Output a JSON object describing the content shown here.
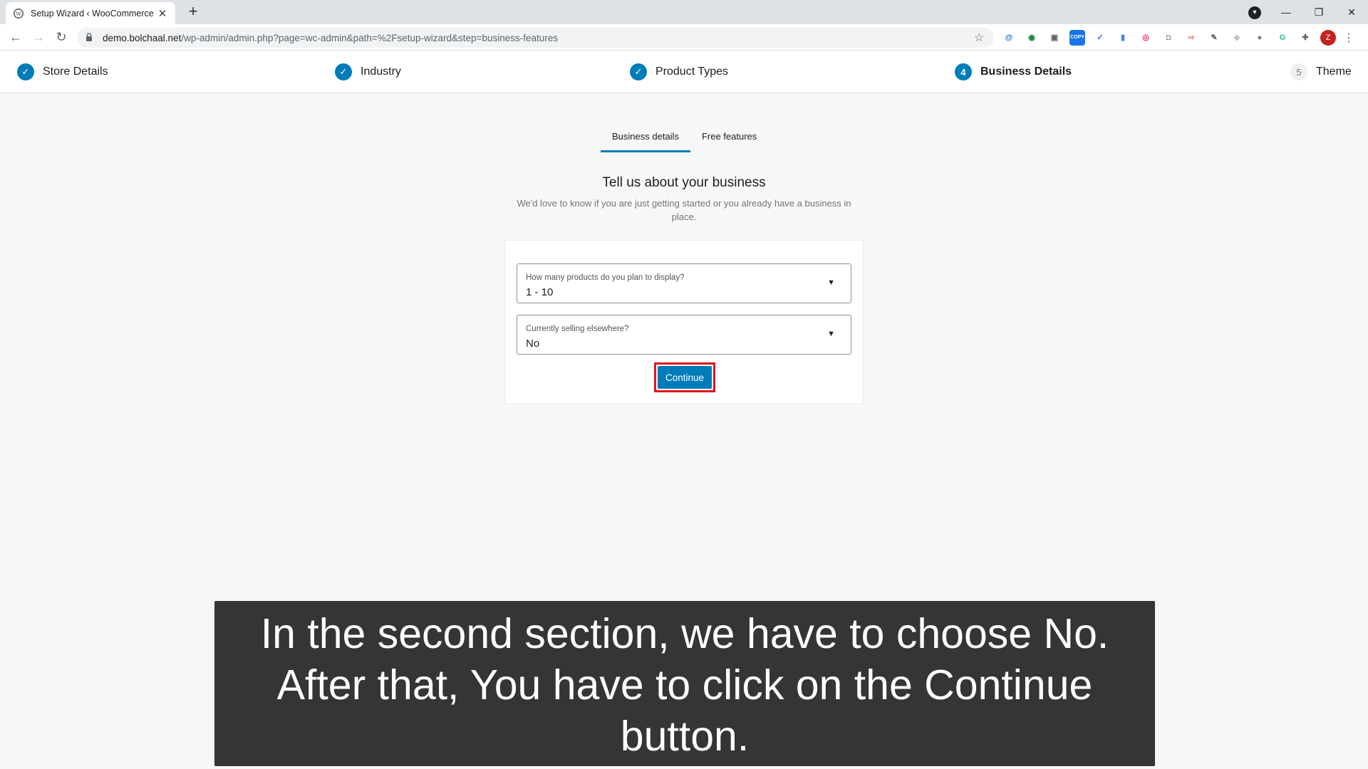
{
  "browser": {
    "tab_title": "Setup Wizard ‹ WooCommerce ‹",
    "tab_close": "✕",
    "new_tab": "+",
    "url_host": "demo.bolchaal.net",
    "url_path": "/wp-admin/admin.php?page=wc-admin&path=%2Fsetup-wizard&step=business-features",
    "avatar_letter": "Z",
    "extensions": [
      {
        "name": "at-icon",
        "glyph": "@",
        "color": "#1a73e8"
      },
      {
        "name": "globe-ext-icon",
        "glyph": "◉",
        "color": "#188038"
      },
      {
        "name": "image-ext-icon",
        "glyph": "▣",
        "color": "#5f6368"
      },
      {
        "name": "copy-ext-icon",
        "glyph": "COPY",
        "color": "#1a73e8"
      },
      {
        "name": "check-ext-icon",
        "glyph": "✓",
        "color": "#1a73e8"
      },
      {
        "name": "bottle-ext-icon",
        "glyph": "▮",
        "color": "#4285f4"
      },
      {
        "name": "instagram-ext-icon",
        "glyph": "◎",
        "color": "#e1306c"
      },
      {
        "name": "camera-ext-icon",
        "glyph": "◘",
        "color": "#80868b"
      },
      {
        "name": "arrow-ext-icon",
        "glyph": "⇨",
        "color": "#e57373"
      },
      {
        "name": "pen-ext-icon",
        "glyph": "✎",
        "color": "#5f6368"
      },
      {
        "name": "shield-ext-icon",
        "glyph": "◈",
        "color": "#bdc1c6"
      },
      {
        "name": "cookie-ext-icon",
        "glyph": "●",
        "color": "#8d6e63"
      },
      {
        "name": "grammarly-ext-icon",
        "glyph": "G",
        "color": "#15c39a"
      },
      {
        "name": "puzzle-ext-icon",
        "glyph": "✚",
        "color": "#5f6368"
      }
    ]
  },
  "stepper": {
    "steps": [
      {
        "label": "Store Details",
        "state": "done"
      },
      {
        "label": "Industry",
        "state": "done"
      },
      {
        "label": "Product Types",
        "state": "done"
      },
      {
        "label": "Business Details",
        "state": "current",
        "number": "4"
      },
      {
        "label": "Theme",
        "state": "todo",
        "number": "5"
      }
    ]
  },
  "page_tabs": {
    "business_details": "Business details",
    "free_features": "Free features"
  },
  "main": {
    "heading": "Tell us about your business",
    "subheading": "We'd love to know if you are just getting started or you already have a business in place."
  },
  "form": {
    "products_label": "How many products do you plan to display?",
    "products_value": "1 - 10",
    "selling_label": "Currently selling elsewhere?",
    "selling_value": "No",
    "continue_label": "Continue"
  },
  "caption": {
    "text": "In the second section, we have to choose No. After that, You have to click on the Continue button."
  },
  "colors": {
    "accent": "#007cba",
    "highlight": "#e0131a",
    "caption_bg": "#353535"
  }
}
